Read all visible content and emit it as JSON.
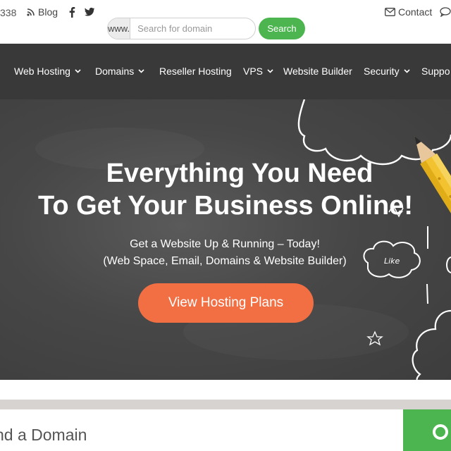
{
  "topbar": {
    "phone_fragment": "338",
    "blog_label": "Blog",
    "search": {
      "prefix": "www.",
      "placeholder": "Search for domain",
      "button_label": "Search"
    },
    "contact_label": "Contact",
    "icons": [
      "rss-icon",
      "facebook-icon",
      "twitter-icon",
      "envelope-icon",
      "chat-icon"
    ]
  },
  "nav": {
    "items": [
      {
        "label": "Web Hosting",
        "dropdown": true
      },
      {
        "label": "Domains",
        "dropdown": true
      },
      {
        "label": "Reseller Hosting",
        "dropdown": false
      },
      {
        "label": "VPS",
        "dropdown": true
      },
      {
        "label": "Website Builder",
        "dropdown": false
      },
      {
        "label": "Security",
        "dropdown": true
      },
      {
        "label": "Suppo",
        "dropdown": false
      }
    ]
  },
  "hero": {
    "headline_line1": "Everything You Need",
    "headline_line2": "To Get Your Business Online!",
    "subline1": "Get a Website Up & Running – Today!",
    "subline2": "(Web Space, Email, Domains & Website Builder)",
    "cta_label": "View Hosting Plans",
    "doodle_text": "Like"
  },
  "domain_search": {
    "label": "nd a Domain"
  },
  "colors": {
    "accent_green": "#4cb54f",
    "cta_orange": "#f26f44",
    "nav_bg": "#393939"
  }
}
